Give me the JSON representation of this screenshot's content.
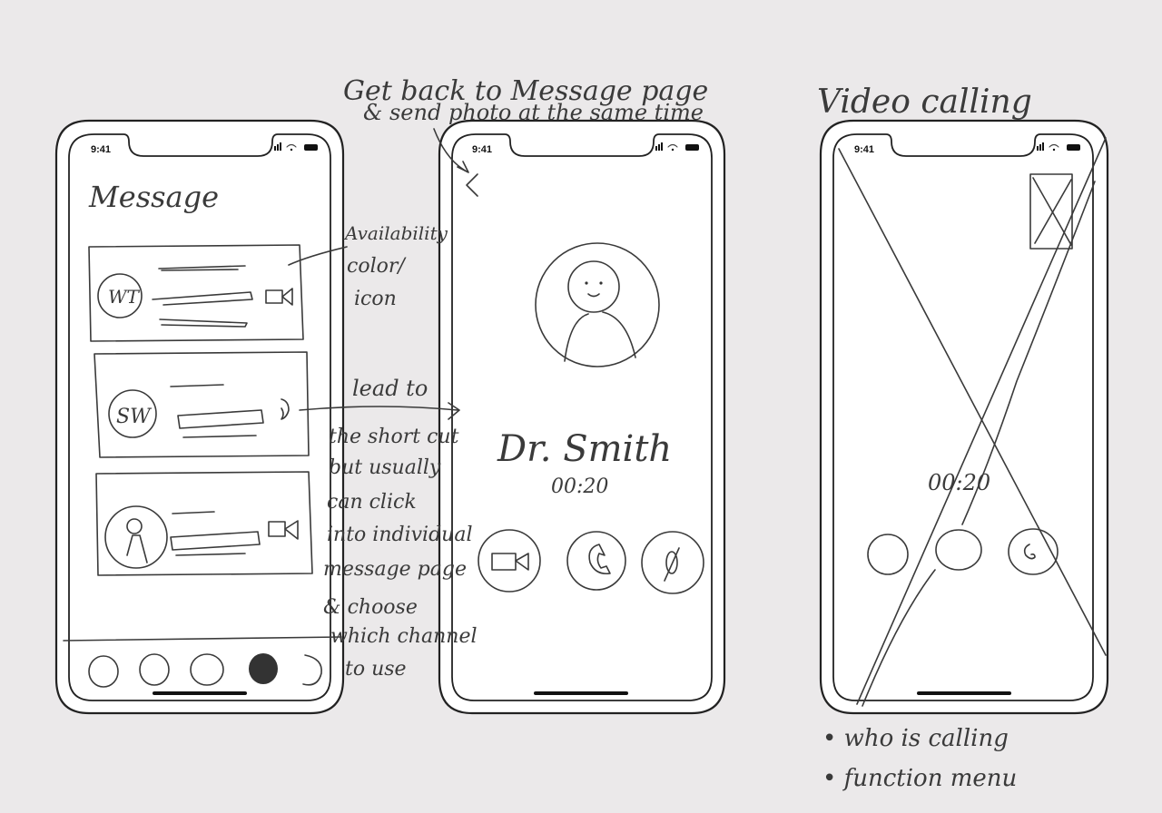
{
  "status_time": "9:41",
  "phone1": {
    "title": "Message",
    "contacts": [
      {
        "avatar": "WT",
        "channel_icon": "video-camera-icon"
      },
      {
        "avatar": "SW",
        "channel_icon": "phone-icon"
      },
      {
        "avatar": "",
        "channel_icon": "video-camera-icon"
      }
    ]
  },
  "phone2": {
    "name": "Dr. Smith",
    "timer": "00:20",
    "buttons": [
      "video-camera-icon",
      "phone-icon",
      "mute-icon"
    ]
  },
  "phone3": {
    "title": "Video calling",
    "timer": "00:20"
  },
  "annotations": {
    "top_note_1": "Get back to Message page",
    "top_note_2": "& send photo at the same time",
    "availability_1": "Availability",
    "availability_2": "color/",
    "availability_3": "icon",
    "lead_to": "lead to",
    "shortcut": [
      "the short cut",
      "but usually",
      "can click",
      "into individual",
      "message page",
      "& choose",
      "which channel",
      "to use"
    ],
    "bullet_1": "• who is calling",
    "bullet_2": "• function menu"
  }
}
